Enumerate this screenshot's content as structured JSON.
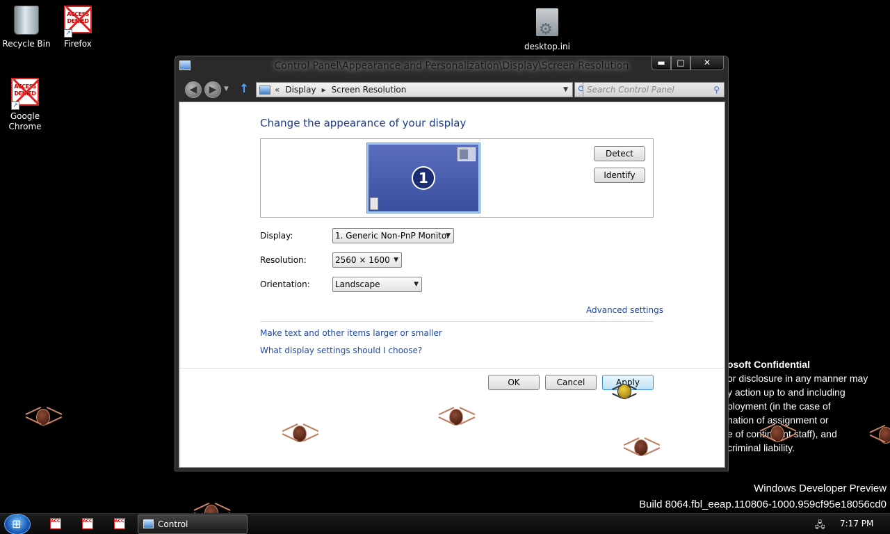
{
  "desktop": {
    "icons": [
      {
        "label": "Recycle Bin"
      },
      {
        "label": "Firefox"
      },
      {
        "label": "Google Chrome"
      },
      {
        "label": "desktop.ini"
      }
    ],
    "access_denied_text": [
      "ACCESS",
      "DENIED"
    ],
    "confidential": {
      "title": "osoft Confidential",
      "lines": [
        "or disclosure in any manner may",
        "y action up to and including",
        "ployment (in the case of",
        "nation of assignment or",
        "e of contingent staff), and",
        "criminal liability."
      ]
    },
    "watermark": {
      "line1": "Windows Developer Preview",
      "line2": "Build 8064.fbl_eeap.110806-1000.959cf95e18056cd0"
    }
  },
  "window": {
    "title": "Control Panel\\Appearance and Personalization\\Display\\Screen Resolution",
    "caption": {
      "minimize": "▬",
      "maximize": "□",
      "close": "✕"
    },
    "address": {
      "overflow": "«",
      "crumbs": [
        "Display",
        "Screen Resolution"
      ],
      "separator": "▸"
    },
    "search": {
      "placeholder": "Search Control Panel"
    },
    "heading": "Change the appearance of your display",
    "monitor_number": "1",
    "buttons": {
      "detect": "Detect",
      "identify": "Identify",
      "ok": "OK",
      "cancel": "Cancel",
      "apply": "Apply"
    },
    "fields": {
      "display": {
        "label": "Display:",
        "value": "1. Generic Non-PnP Monitor"
      },
      "resolution": {
        "label": "Resolution:",
        "value": "2560 × 1600"
      },
      "orientation": {
        "label": "Orientation:",
        "value": "Landscape"
      }
    },
    "links": {
      "advanced": "Advanced settings",
      "text_size": "Make text and other items larger or smaller",
      "which_settings": "What display settings should I choose?"
    }
  },
  "taskbar": {
    "active_task": "Control Panel\\Appea...",
    "clock": "7:17 PM"
  }
}
